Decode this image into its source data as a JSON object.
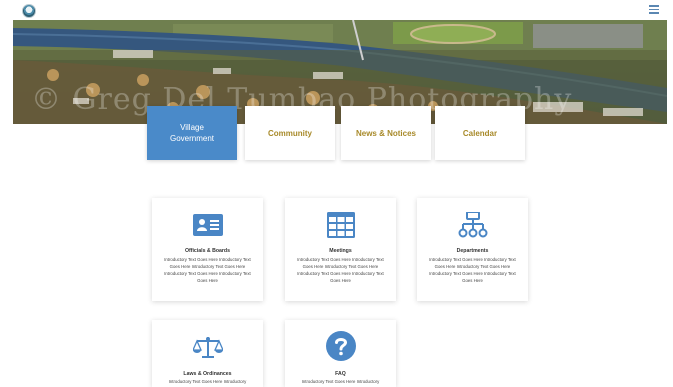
{
  "header": {
    "logo_icon": "village-seal-logo",
    "menu_icon": "hamburger-menu-icon"
  },
  "hero": {
    "watermark": "© Greg Del Tumbao Photography"
  },
  "nav": {
    "tabs": [
      {
        "label": "Village Government",
        "active": true
      },
      {
        "label": "Community",
        "active": false
      },
      {
        "label": "News & Notices",
        "active": false
      },
      {
        "label": "Calendar",
        "active": false
      }
    ]
  },
  "cards": [
    {
      "title": "Officials & Boards",
      "icon": "id-card-icon",
      "desc": "Introductory Text Goes Here Introductory Text Goes Here Introductory Text Goes Here Introductory Text Goes Here Introductory Text Goes Here"
    },
    {
      "title": "Meetings",
      "icon": "grid-calendar-icon",
      "desc": "Introductory Text Goes Here Introductory Text Goes Here Introductory Text Goes Here Introductory Text Goes Here Introductory Text Goes Here"
    },
    {
      "title": "Departments",
      "icon": "org-chart-icon",
      "desc": "Introductory Text Goes Here Introductory Text Goes Here Introductory Text Goes Here Introductory Text Goes Here Introductory Text Goes Here"
    },
    {
      "title": "Laws & Ordinances",
      "icon": "scales-icon",
      "desc": "Introductory Text Goes Here Introductory"
    },
    {
      "title": "FAQ",
      "icon": "question-circle-icon",
      "desc": "Introductory Text Goes Here Introductory"
    }
  ],
  "colors": {
    "accent_blue": "#4a8ac9",
    "tab_gold": "#a88a2a",
    "icon_blue": "#4a86c5"
  }
}
